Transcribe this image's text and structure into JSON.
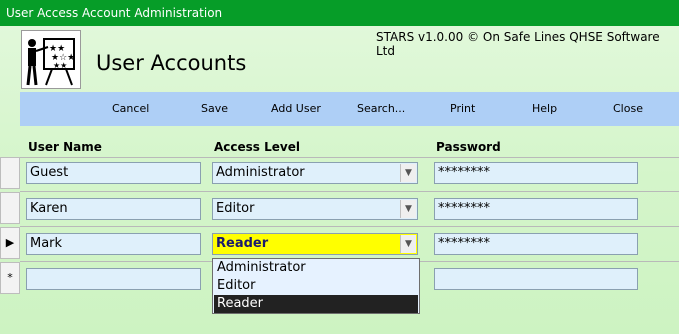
{
  "window": {
    "title": "User Access Account Administration"
  },
  "header": {
    "copyright": "STARS v1.0.00 © On Safe Lines QHSE Software Ltd",
    "heading": "User Accounts"
  },
  "toolbar": {
    "cancel": "Cancel",
    "save": "Save",
    "add_user": "Add User",
    "search": "Search...",
    "print": "Print",
    "help": "Help",
    "close": "Close"
  },
  "columns": {
    "user_name": "User Name",
    "access_level": "Access Level",
    "password": "Password"
  },
  "rows": [
    {
      "user": "Guest",
      "level": "Administrator",
      "password": "********",
      "selector": ""
    },
    {
      "user": "Karen",
      "level": "Editor",
      "password": "********",
      "selector": ""
    },
    {
      "user": "Mark",
      "level": "Reader",
      "password": "********",
      "selector": "▶"
    },
    {
      "user": "",
      "level": "",
      "password": "",
      "selector": "*"
    }
  ],
  "dropdown": {
    "options": [
      "Administrator",
      "Editor",
      "Reader"
    ],
    "selected": "Reader"
  },
  "icons": {
    "combo_arrow": "chevron-down-icon",
    "logo": "presenter-board-icon"
  }
}
